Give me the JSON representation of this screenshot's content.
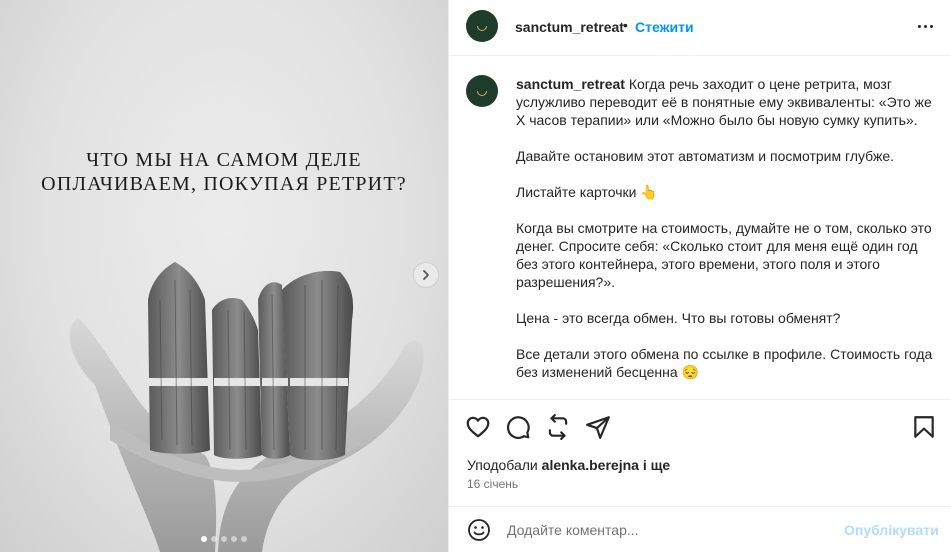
{
  "post": {
    "username": "sanctum_retreat",
    "follow_label": "Стежити",
    "separator": "•",
    "media": {
      "title_lines": [
        "ЧТО МЫ НА САМОМ ДЕЛЕ",
        "ОПЛАЧИВАЕМ, ПОКУПАЯ РЕТРИТ?"
      ],
      "slides_total": 5,
      "active_slide": 1
    },
    "caption": {
      "username": "sanctum_retreat",
      "paragraphs": [
        "Когда речь заходит о цене ретрита, мозг услужливо переводит её в понятные ему эквиваленты: «Это же Х часов терапии» или «Можно было бы новую сумку купить».",
        "Давайте остановим этот автоматизм и посмотрим глубже.",
        "Листайте карточки 👆",
        "Когда вы смотрите на стоимость, думайте не о том, сколько это денег. Спросите себя: «Сколько стоит для меня ещё один год без этого контейнера, этого времени, этого поля и этого разрешения?».",
        "Цена - это всегда обмен. Что вы готовы обменят?",
        "Все детали этого обмена по ссылке в профиле. Стоимость года без изменений бесценна 😔"
      ]
    },
    "likes": {
      "prefix": "Уподобали",
      "user": "alenka.berejna",
      "suffix": "і ще"
    },
    "date": "16 січень",
    "comment": {
      "placeholder": "Додайте коментар...",
      "publish_label": "Опублікувати"
    },
    "icons": {
      "like": "heart-icon",
      "comment": "comment-icon",
      "repost": "repost-icon",
      "share": "share-icon",
      "save": "bookmark-icon",
      "more": "more-icon",
      "emoji": "emoji-icon",
      "next": "chevron-right-icon"
    },
    "colors": {
      "accent": "#0095f6",
      "publish_disabled": "#b3dbff",
      "avatar_bg": "#1f3b2c"
    }
  }
}
